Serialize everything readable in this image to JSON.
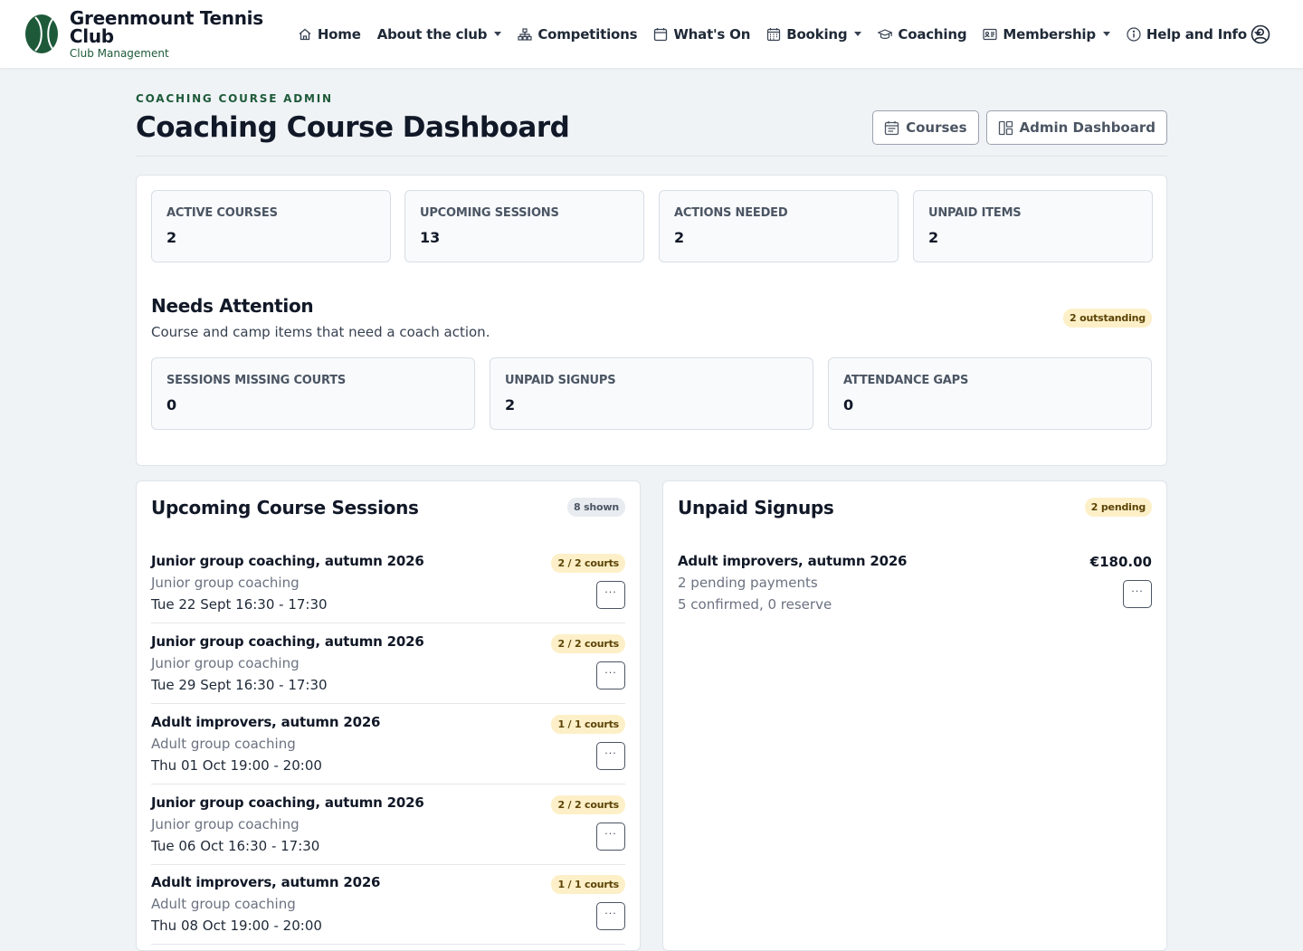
{
  "brand": {
    "title": "Greenmount Tennis Club",
    "subtitle": "Club Management"
  },
  "nav": [
    {
      "label": "Home",
      "icon": "home-icon",
      "dropdown": false
    },
    {
      "label": "About the club",
      "icon": "",
      "dropdown": true
    },
    {
      "label": "Competitions",
      "icon": "sitemap-icon",
      "dropdown": false
    },
    {
      "label": "What's On",
      "icon": "calendar-icon",
      "dropdown": false
    },
    {
      "label": "Booking",
      "icon": "calendar-grid-icon",
      "dropdown": true
    },
    {
      "label": "Coaching",
      "icon": "graduation-cap-icon",
      "dropdown": false
    },
    {
      "label": "Membership",
      "icon": "id-card-icon",
      "dropdown": true
    },
    {
      "label": "Help and Info",
      "icon": "info-icon",
      "dropdown": true
    }
  ],
  "header": {
    "eyebrow": "COACHING COURSE ADMIN",
    "title": "Coaching Course Dashboard",
    "courses_btn": "Courses",
    "admin_btn": "Admin Dashboard"
  },
  "stats": [
    {
      "label": "ACTIVE COURSES",
      "value": "2"
    },
    {
      "label": "UPCOMING SESSIONS",
      "value": "13"
    },
    {
      "label": "ACTIONS NEEDED",
      "value": "2"
    },
    {
      "label": "UNPAID ITEMS",
      "value": "2"
    }
  ],
  "attention": {
    "title": "Needs Attention",
    "subtitle": "Course and camp items that need a coach action.",
    "badge": "2 outstanding",
    "items": [
      {
        "label": "SESSIONS MISSING COURTS",
        "value": "0"
      },
      {
        "label": "UNPAID SIGNUPS",
        "value": "2"
      },
      {
        "label": "ATTENDANCE GAPS",
        "value": "0"
      }
    ]
  },
  "sessions": {
    "title": "Upcoming Course Sessions",
    "badge": "8 shown",
    "more": "···",
    "items": [
      {
        "title": "Junior group coaching, autumn 2026",
        "type": "Junior group coaching",
        "time": "Tue 22 Sept 16:30 - 17:30",
        "courts": "2 / 2 courts"
      },
      {
        "title": "Junior group coaching, autumn 2026",
        "type": "Junior group coaching",
        "time": "Tue 29 Sept 16:30 - 17:30",
        "courts": "2 / 2 courts"
      },
      {
        "title": "Adult improvers, autumn 2026",
        "type": "Adult group coaching",
        "time": "Thu 01 Oct 19:00 - 20:00",
        "courts": "1 / 1 courts"
      },
      {
        "title": "Junior group coaching, autumn 2026",
        "type": "Junior group coaching",
        "time": "Tue 06 Oct 16:30 - 17:30",
        "courts": "2 / 2 courts"
      },
      {
        "title": "Adult improvers, autumn 2026",
        "type": "Adult group coaching",
        "time": "Thu 08 Oct 19:00 - 20:00",
        "courts": "1 / 1 courts"
      }
    ]
  },
  "unpaid": {
    "title": "Unpaid Signups",
    "badge": "2 pending",
    "item": {
      "title": "Adult improvers, autumn 2026",
      "payments": "2 pending payments",
      "status": "5 confirmed, 0 reserve",
      "price": "€180.00"
    }
  },
  "colors": {
    "brand_green": "#1e5a3a",
    "warn_pill": "#fdf0c8",
    "background": "#eff3f6"
  }
}
